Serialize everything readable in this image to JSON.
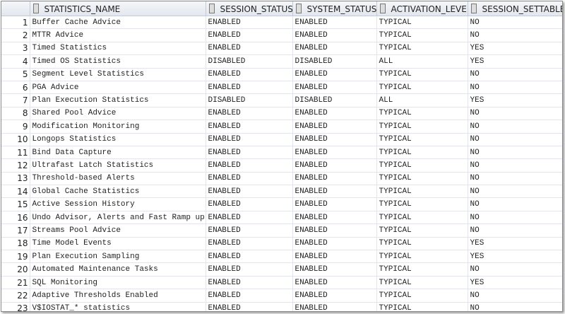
{
  "columns": [
    "STATISTICS_NAME",
    "SESSION_STATUS",
    "SYSTEM_STATUS",
    "ACTIVATION_LEVEL",
    "SESSION_SETTABLE"
  ],
  "rows": [
    [
      "1",
      "Buffer Cache Advice",
      "ENABLED",
      "ENABLED",
      "TYPICAL",
      "NO"
    ],
    [
      "2",
      "MTTR Advice",
      "ENABLED",
      "ENABLED",
      "TYPICAL",
      "NO"
    ],
    [
      "3",
      "Timed Statistics",
      "ENABLED",
      "ENABLED",
      "TYPICAL",
      "YES"
    ],
    [
      "4",
      "Timed OS Statistics",
      "DISABLED",
      "DISABLED",
      "ALL",
      "YES"
    ],
    [
      "5",
      "Segment Level Statistics",
      "ENABLED",
      "ENABLED",
      "TYPICAL",
      "NO"
    ],
    [
      "6",
      "PGA Advice",
      "ENABLED",
      "ENABLED",
      "TYPICAL",
      "NO"
    ],
    [
      "7",
      "Plan Execution Statistics",
      "DISABLED",
      "DISABLED",
      "ALL",
      "YES"
    ],
    [
      "8",
      "Shared Pool Advice",
      "ENABLED",
      "ENABLED",
      "TYPICAL",
      "NO"
    ],
    [
      "9",
      "Modification Monitoring",
      "ENABLED",
      "ENABLED",
      "TYPICAL",
      "NO"
    ],
    [
      "10",
      "Longops Statistics",
      "ENABLED",
      "ENABLED",
      "TYPICAL",
      "NO"
    ],
    [
      "11",
      "Bind Data Capture",
      "ENABLED",
      "ENABLED",
      "TYPICAL",
      "NO"
    ],
    [
      "12",
      "Ultrafast Latch Statistics",
      "ENABLED",
      "ENABLED",
      "TYPICAL",
      "NO"
    ],
    [
      "13",
      "Threshold-based Alerts",
      "ENABLED",
      "ENABLED",
      "TYPICAL",
      "NO"
    ],
    [
      "14",
      "Global Cache Statistics",
      "ENABLED",
      "ENABLED",
      "TYPICAL",
      "NO"
    ],
    [
      "15",
      "Active Session History",
      "ENABLED",
      "ENABLED",
      "TYPICAL",
      "NO"
    ],
    [
      "16",
      "Undo Advisor, Alerts and Fast Ramp up",
      "ENABLED",
      "ENABLED",
      "TYPICAL",
      "NO"
    ],
    [
      "17",
      "Streams Pool Advice",
      "ENABLED",
      "ENABLED",
      "TYPICAL",
      "NO"
    ],
    [
      "18",
      "Time Model Events",
      "ENABLED",
      "ENABLED",
      "TYPICAL",
      "YES"
    ],
    [
      "19",
      "Plan Execution Sampling",
      "ENABLED",
      "ENABLED",
      "TYPICAL",
      "YES"
    ],
    [
      "20",
      "Automated Maintenance Tasks",
      "ENABLED",
      "ENABLED",
      "TYPICAL",
      "NO"
    ],
    [
      "21",
      "SQL Monitoring",
      "ENABLED",
      "ENABLED",
      "TYPICAL",
      "YES"
    ],
    [
      "22",
      "Adaptive Thresholds Enabled",
      "ENABLED",
      "ENABLED",
      "TYPICAL",
      "NO"
    ],
    [
      "23",
      "V$IOSTAT_* statistics",
      "ENABLED",
      "ENABLED",
      "TYPICAL",
      "NO"
    ]
  ]
}
